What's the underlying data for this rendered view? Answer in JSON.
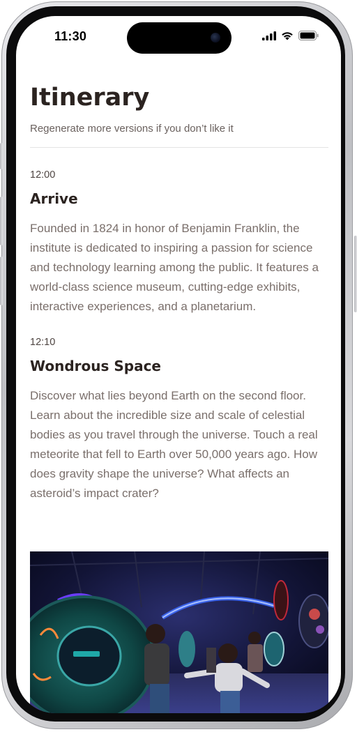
{
  "status_bar": {
    "time": "11:30",
    "icons": [
      "cellular-signal-icon",
      "wifi-icon",
      "battery-icon"
    ]
  },
  "page": {
    "title": "Itinerary",
    "subtitle": "Regenerate more versions if you don’t like it"
  },
  "itinerary": [
    {
      "time": "12:00",
      "title": "Arrive",
      "description": "Founded in 1824 in honor of Benjamin Franklin, the institute is dedicated to inspiring a passion for science and technology learning among the public. It features a world-class science museum, cutting-edge exhibits, interactive experiences, and a planetarium."
    },
    {
      "time": "12:10",
      "title": "Wondrous Space",
      "description": "Discover what lies beyond Earth on the second floor. Learn about the incredible size and scale of celestial bodies as you travel through the universe. Touch a real meteorite that fell to Earth over 50,000 years ago. How does gravity shape the universe? What affects an asteroid’s impact crater?"
    }
  ],
  "colors": {
    "heading": "#2b2320",
    "body_text": "#7a6f6b",
    "time_text": "#4e4542",
    "divider": "#e3e3e3"
  }
}
